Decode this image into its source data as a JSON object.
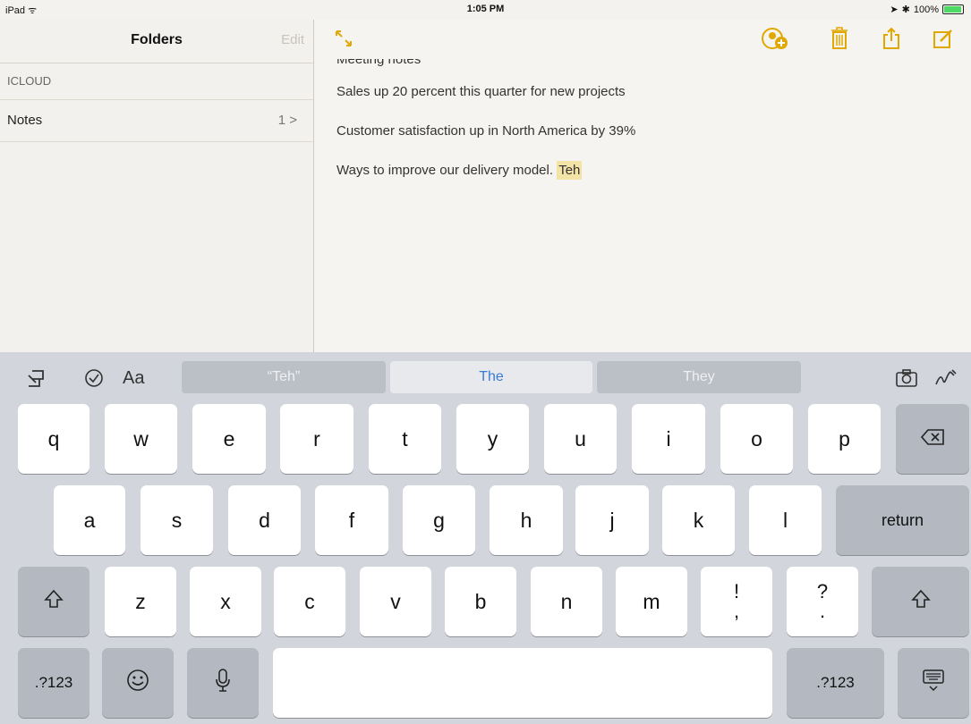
{
  "status": {
    "left": "iPad ᯤ",
    "time": "1:05 PM",
    "battery": "100%"
  },
  "sidebar": {
    "title": "Folders",
    "edit": "Edit",
    "section": "ICLOUD",
    "folder": {
      "name": "Notes",
      "count": "1 >"
    }
  },
  "note": {
    "title": "Meeting notes",
    "lines": [
      "Sales up 20 percent this quarter for new projects",
      "Customer satisfaction up in North America by 39%"
    ],
    "last_line": "Ways to improve our delivery model.",
    "highlight": "Teh"
  },
  "keyboard": {
    "suggestions": {
      "left": "“Teh”",
      "middle": "The",
      "right": "They"
    },
    "format_label": "Aa",
    "row1": [
      "q",
      "w",
      "e",
      "r",
      "t",
      "y",
      "u",
      "i",
      "o",
      "p"
    ],
    "row2": [
      "a",
      "s",
      "d",
      "f",
      "g",
      "h",
      "j",
      "k",
      "l"
    ],
    "row3": [
      "z",
      "x",
      "c",
      "v",
      "b",
      "n",
      "m"
    ],
    "punct1": [
      "!",
      ","
    ],
    "punct2": [
      "?",
      "."
    ],
    "return_label": "return",
    "numbers_label": ".?123"
  },
  "icons": [
    "undo-icon",
    "checklist-icon",
    "camera-icon",
    "sketch-icon",
    "expand-icon",
    "add-people-icon",
    "trash-icon",
    "share-icon",
    "compose-icon",
    "shift-icon",
    "delete-icon",
    "emoji-icon",
    "mic-icon",
    "keyboard-dismiss-icon"
  ],
  "colors": {
    "accent": "#e0a800",
    "suggestion_text": "#3a7bd5",
    "highlight": "#f3e3a6"
  }
}
